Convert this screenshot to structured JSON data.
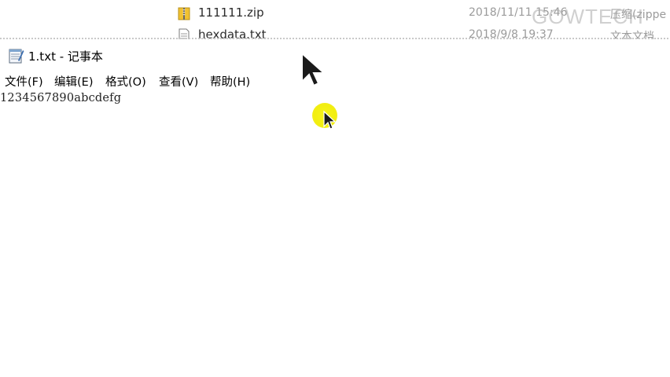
{
  "explorer": {
    "files": [
      {
        "name": "111111.zip",
        "date": "2018/11/11 15:46",
        "type": "压缩(zippe",
        "icon": "zip-folder-icon"
      },
      {
        "name": "hexdata.txt",
        "date": "2018/9/8 19:37",
        "type": "文本文档",
        "icon": "text-file-icon"
      }
    ],
    "watermark": "GOWTECH"
  },
  "window": {
    "title": "1.txt - 记事本",
    "icon": "notepad-icon"
  },
  "menu": {
    "items": [
      {
        "label": "文件(F)"
      },
      {
        "label": "编辑(E)"
      },
      {
        "label": "格式(O)"
      },
      {
        "label": "查看(V)"
      },
      {
        "label": "帮助(H)"
      }
    ]
  },
  "editor": {
    "content": "1234567890abcdefg"
  },
  "colors": {
    "highlight": "#f2ee10",
    "cursor": "#1a1a1a"
  }
}
